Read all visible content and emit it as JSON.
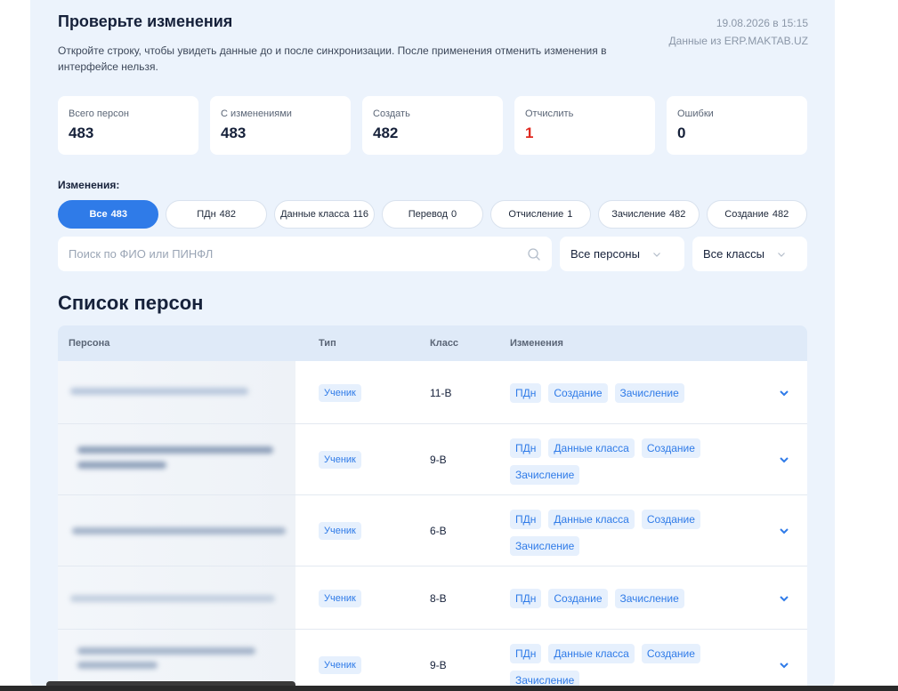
{
  "header": {
    "title": "Проверьте изменения",
    "subtitle": "Откройте строку, чтобы увидеть данные до и после синхронизации. После применения отменить изменения в интерфейсе нельзя.",
    "datetime": "19.08.2026 в 15:15",
    "source": "Данные из ERP.MAKTAB.UZ"
  },
  "stats": [
    {
      "label": "Всего персон",
      "value": "483"
    },
    {
      "label": "С изменениями",
      "value": "483"
    },
    {
      "label": "Создать",
      "value": "482"
    },
    {
      "label": "Отчислить",
      "value": "1"
    },
    {
      "label": "Ошибки",
      "value": "0"
    }
  ],
  "changes_label": "Изменения:",
  "filters": [
    {
      "label": "Все",
      "count": "483"
    },
    {
      "label": "ПДн",
      "count": "482"
    },
    {
      "label": "Данные класса",
      "count": "116"
    },
    {
      "label": "Перевод",
      "count": "0"
    },
    {
      "label": "Отчисление",
      "count": "1"
    },
    {
      "label": "Зачисление",
      "count": "482"
    },
    {
      "label": "Создание",
      "count": "482"
    }
  ],
  "search": {
    "placeholder": "Поиск по ФИО или ПИНФЛ"
  },
  "select_persons": "Все персоны",
  "select_classes": "Все классы",
  "list_title": "Список персон",
  "table": {
    "columns": [
      "Персона",
      "Тип",
      "Класс",
      "Изменения"
    ],
    "rows": [
      {
        "type": "Ученик",
        "class": "11-В",
        "tags": [
          "ПДн",
          "Создание",
          "Зачисление"
        ]
      },
      {
        "type": "Ученик",
        "class": "9-В",
        "tags": [
          "ПДн",
          "Данные класса",
          "Создание",
          "Зачисление"
        ]
      },
      {
        "type": "Ученик",
        "class": "6-В",
        "tags": [
          "ПДн",
          "Данные класса",
          "Создание",
          "Зачисление"
        ]
      },
      {
        "type": "Ученик",
        "class": "8-В",
        "tags": [
          "ПДн",
          "Создание",
          "Зачисление"
        ]
      },
      {
        "type": "Ученик",
        "class": "9-В",
        "tags": [
          "ПДн",
          "Данные класса",
          "Создание",
          "Зачисление"
        ]
      }
    ]
  },
  "colors": {
    "accent": "#2f7be8",
    "danger": "#e0281f",
    "panel": "#ecf3fc"
  }
}
